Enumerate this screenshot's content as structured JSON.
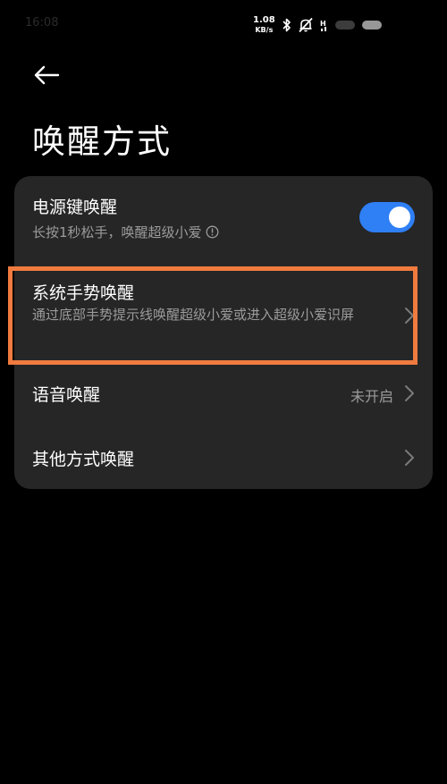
{
  "status_bar": {
    "time": "16:08",
    "net_speed_value": "1.08",
    "net_speed_unit": "KB/s",
    "icons": [
      "bluetooth-icon",
      "mute-icon",
      "signal-icon",
      "wifi-icon",
      "battery-icon"
    ]
  },
  "header": {
    "back_icon": "arrow-left-icon",
    "title": "唤醒方式"
  },
  "settings": {
    "items": [
      {
        "title": "电源键唤醒",
        "subtitle": "长按1秒松手，唤醒超级小爱",
        "info_icon": "info-icon",
        "control": "toggle",
        "toggle_on": true
      },
      {
        "title": "系统手势唤醒",
        "subtitle": "通过底部手势提示线唤醒超级小爱或进入超级小爱识屏",
        "control": "chevron",
        "highlighted": true
      },
      {
        "title": "语音唤醒",
        "value": "未开启",
        "control": "chevron"
      },
      {
        "title": "其他方式唤醒",
        "control": "chevron"
      }
    ]
  },
  "colors": {
    "background": "#000000",
    "card": "#262626",
    "accent": "#2f7ff5",
    "highlight": "#f07b3f",
    "secondary_text": "#9b9b9b"
  }
}
